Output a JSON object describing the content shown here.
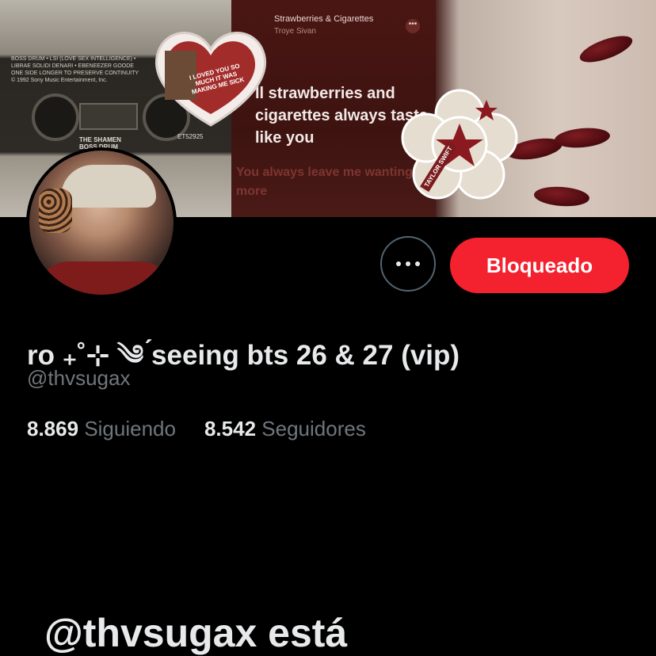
{
  "banner": {
    "cassette": {
      "label_lines": [
        "BOSS DRUM • LSI (LOVE SEX INTELLIGENCE) •",
        "LIBRAE SOLIDI DENARI • EBENEEZER GOODE",
        "ONE SIDE LONGER TO PRESERVE CONTINUITY",
        "© 1992 Sony Music Entertainment, Inc."
      ],
      "brand": "THE SHAMEN",
      "brand_sub": "BOSS DRUM",
      "code": "ET52925"
    },
    "song": {
      "title": "Strawberries & Cigarettes",
      "artist": "Troye Sivan",
      "more": "•••",
      "lyric_main": "ll strawberries and cigarettes always taste like you",
      "lyric_next": "You always leave me wanting more"
    },
    "heart_text": "I LOVED YOU SO MUCH IT WAS MAKING ME SICK",
    "flower_tag": "TAYLOR SWIFT"
  },
  "profile": {
    "display_name": "ro ₊˚⊹ ༄ ́seeing bts 26 & 27 (vip)",
    "handle": "@thvsugax",
    "following_count": "8.869",
    "following_label": "Siguiendo",
    "followers_count": "8.542",
    "followers_label": "Seguidores",
    "block_button": "Bloqueado"
  },
  "blocked_message": "@thvsugax está",
  "colors": {
    "background": "#000000",
    "block_red": "#f4212e",
    "secondary_text": "#71767b",
    "primary_text": "#e7e9ea"
  }
}
